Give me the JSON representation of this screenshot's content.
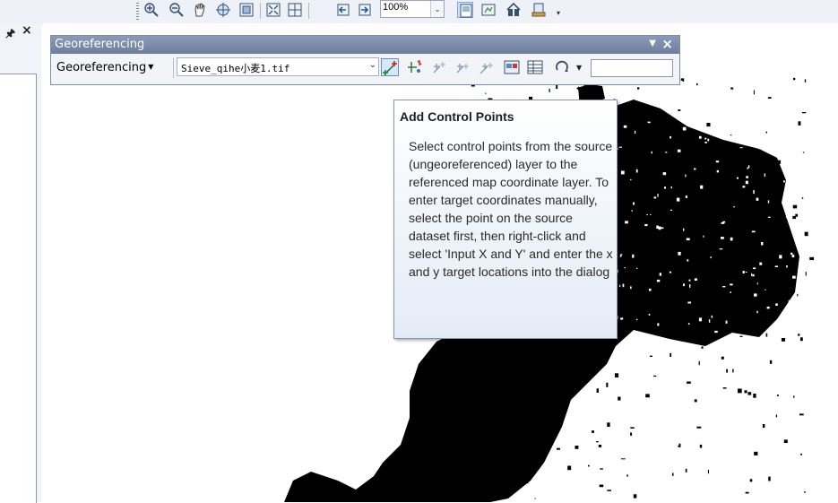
{
  "top_toolbar": {
    "zoom_value": "100%",
    "icons": [
      "zoom-in-icon",
      "zoom-out-icon",
      "pan-icon",
      "full-extent-icon",
      "fixed-zoom-icon",
      "zoom-to-layer-icon",
      "grid-icon",
      "back-icon",
      "forward-icon",
      "layout-page-icon",
      "refresh-icon",
      "tools-icon",
      "toggle-icon"
    ]
  },
  "left_panel": {
    "pin_glyph": "1",
    "close_glyph": "×"
  },
  "georeferencing": {
    "title": "Georeferencing",
    "menu_label": "Georeferencing",
    "layer": "Sieve_qihe小麦1.tif",
    "close_glyph": "×",
    "transform_value": ""
  },
  "tooltip": {
    "title": "Add Control Points",
    "body": "Select control points from the source (ungeoreferenced) layer to the referenced map coordinate layer. To enter target coordinates manually, select the point on the source dataset first, then right-click and select 'Input X and Y' and enter the x and y target locations into the dialog"
  },
  "colors": {
    "map_background": "#ffffff",
    "raster": "#000000",
    "titlebar": "#7a8cab"
  }
}
